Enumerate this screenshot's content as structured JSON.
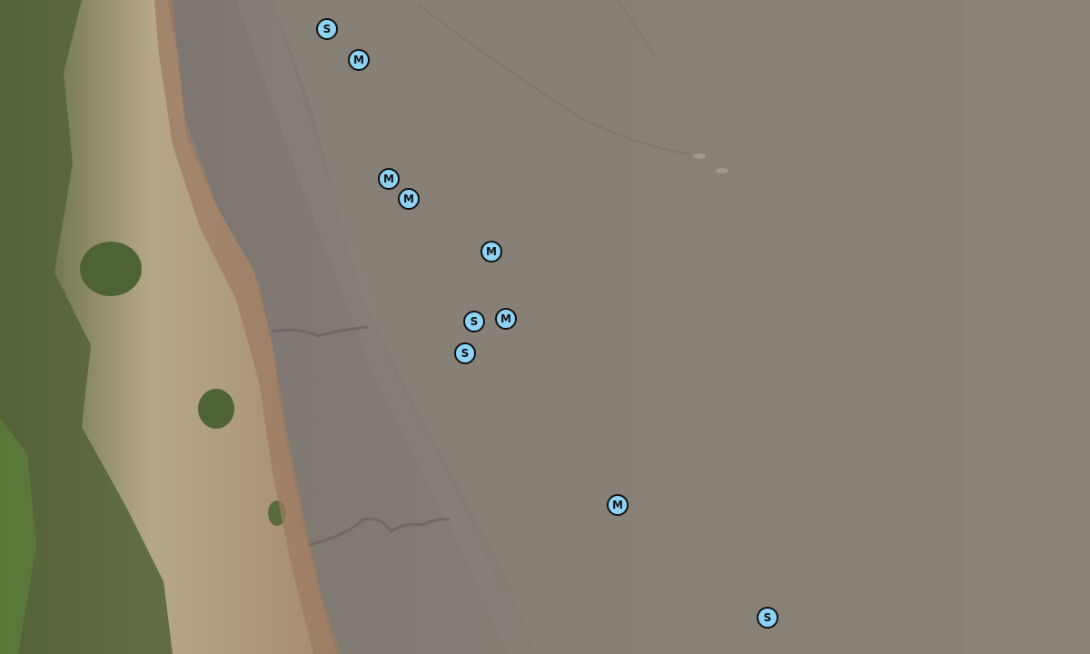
{
  "map": {
    "marker_style": {
      "fill": "#8fd3f4",
      "stroke": "#111111"
    },
    "markers": [
      {
        "label": "S"
      },
      {
        "label": "M"
      },
      {
        "label": "M"
      },
      {
        "label": "M"
      },
      {
        "label": "M"
      },
      {
        "label": "S"
      },
      {
        "label": "M"
      },
      {
        "label": "S"
      },
      {
        "label": "M"
      },
      {
        "label": "S"
      }
    ]
  }
}
